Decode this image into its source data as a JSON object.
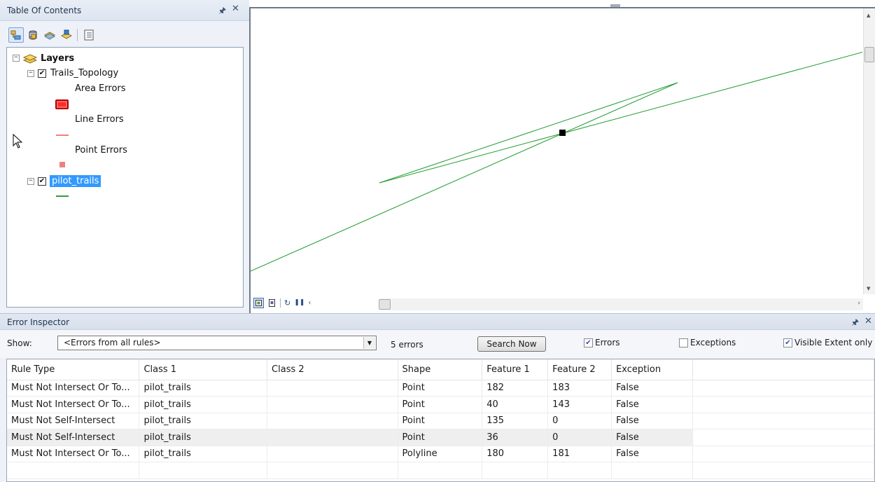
{
  "toc": {
    "title": "Table Of Contents",
    "pin_icon": "pin-icon",
    "close_icon": "close-icon",
    "toolbar": [
      "list-by-drawing-order-icon",
      "list-by-source-icon",
      "list-by-visibility-icon",
      "list-by-selection-icon",
      "options-icon"
    ],
    "layers_label": "Layers",
    "items": {
      "trails_topology": "Trails_Topology",
      "area_errors": "Area Errors",
      "line_errors": "Line Errors",
      "point_errors": "Point Errors",
      "pilot_trails": "pilot_trails"
    },
    "colors": {
      "area_error_fill": "#ff0000",
      "line_error": "#f08080",
      "point_error": "#f08080",
      "pilot_trails_line": "#2e9e3a",
      "selection": "#3399ff"
    }
  },
  "map": {
    "line_color": "#1f9b2f",
    "error_marker_color": "#000000",
    "bottom_tools": [
      "data-view-icon",
      "layout-view-icon",
      "refresh-icon",
      "pause-icon",
      "scroll-left-icon"
    ]
  },
  "error_inspector": {
    "title": "Error Inspector",
    "show_label": "Show:",
    "show_value": "<Errors from all rules>",
    "count": "5 errors",
    "search_button": "Search Now",
    "errors_label": "Errors",
    "errors_checked": true,
    "exceptions_label": "Exceptions",
    "exceptions_checked": false,
    "visible_extent_label": "Visible Extent only",
    "visible_extent_checked": true,
    "columns": [
      "Rule Type",
      "Class 1",
      "Class 2",
      "Shape",
      "Feature 1",
      "Feature 2",
      "Exception"
    ],
    "rows": [
      [
        "Must Not Intersect Or To...",
        "pilot_trails",
        "",
        "Point",
        "182",
        "183",
        "False"
      ],
      [
        "Must Not Intersect Or To...",
        "pilot_trails",
        "",
        "Point",
        "40",
        "143",
        "False"
      ],
      [
        "Must Not Self-Intersect",
        "pilot_trails",
        "",
        "Point",
        "135",
        "0",
        "False"
      ],
      [
        "Must Not Self-Intersect",
        "pilot_trails",
        "",
        "Point",
        "36",
        "0",
        "False"
      ],
      [
        "Must Not Intersect Or To...",
        "pilot_trails",
        "",
        "Polyline",
        "180",
        "181",
        "False"
      ]
    ]
  }
}
